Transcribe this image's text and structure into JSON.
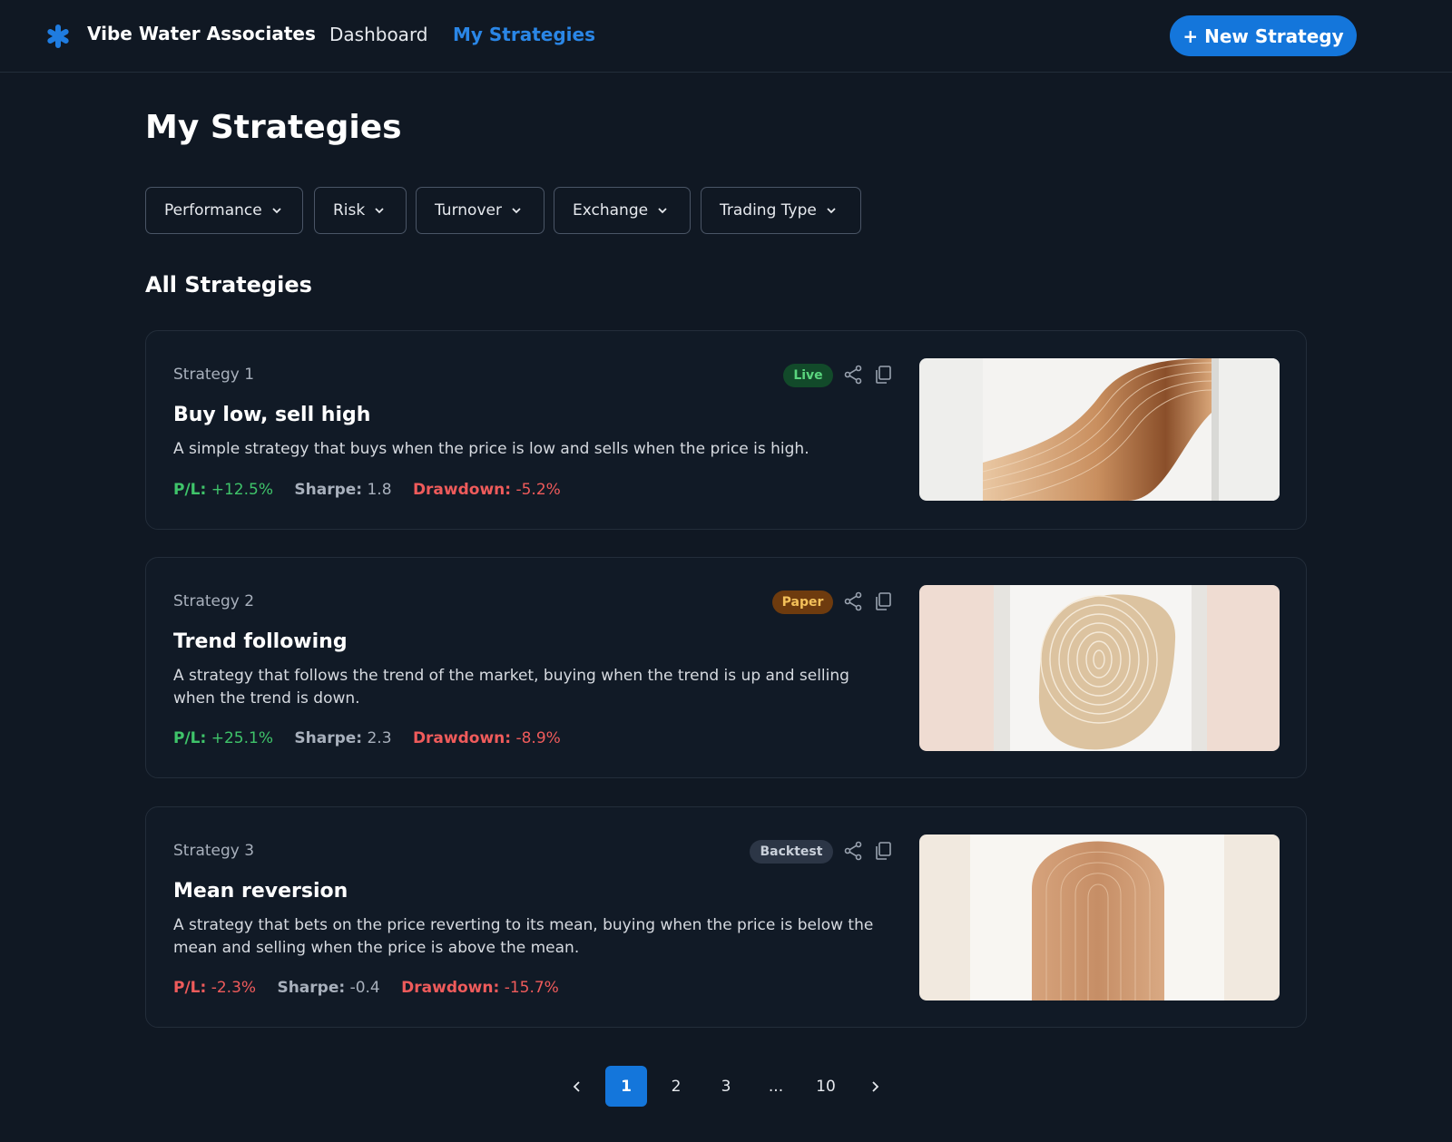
{
  "header": {
    "brand": "Vibe Water Associates",
    "nav": [
      {
        "label": "Dashboard",
        "active": false
      },
      {
        "label": "My Strategies",
        "active": true
      }
    ],
    "new_button": "+ New Strategy",
    "accent_color": "#1476db",
    "logo_icon": "asterisk-icon"
  },
  "page": {
    "title": "My Strategies",
    "section_title": "All Strategies"
  },
  "filters": [
    {
      "label": "Performance"
    },
    {
      "label": "Risk"
    },
    {
      "label": "Turnover"
    },
    {
      "label": "Exchange"
    },
    {
      "label": "Trading Type"
    }
  ],
  "strategies": [
    {
      "number": "Strategy 1",
      "status": "Live",
      "name": "Buy low, sell high",
      "description": "A simple strategy that buys when the price is low and sells when the price is high.",
      "pl_label": "P/L:",
      "pl_value": "+12.5%",
      "sharpe_label": "Sharpe:",
      "sharpe_value": "1.8",
      "drawdown_label": "Drawdown:",
      "drawdown_value": "-5.2%",
      "image_icon": "wavy-wood-art-image"
    },
    {
      "number": "Strategy 2",
      "status": "Paper",
      "name": "Trend following",
      "description": "A strategy that follows the trend of the market, buying when the trend is up and selling when the trend is down.",
      "pl_label": "P/L:",
      "pl_value": "+25.1%",
      "sharpe_label": "Sharpe:",
      "sharpe_value": "2.3",
      "drawdown_label": "Drawdown:",
      "drawdown_value": "-8.9%",
      "image_icon": "tree-ring-art-image"
    },
    {
      "number": "Strategy 3",
      "status": "Backtest",
      "name": "Mean reversion",
      "description": "A strategy that bets on the price reverting to its mean, buying when the price is below the mean and selling when the price is above the mean.",
      "pl_label": "P/L:",
      "pl_value": "-2.3%",
      "sharpe_label": "Sharpe:",
      "sharpe_value": "-0.4",
      "drawdown_label": "Drawdown:",
      "drawdown_value": "-15.7%",
      "image_icon": "arch-art-image"
    }
  ],
  "pagination": {
    "pages": [
      "1",
      "2",
      "3",
      "...",
      "10"
    ],
    "current": "1"
  }
}
